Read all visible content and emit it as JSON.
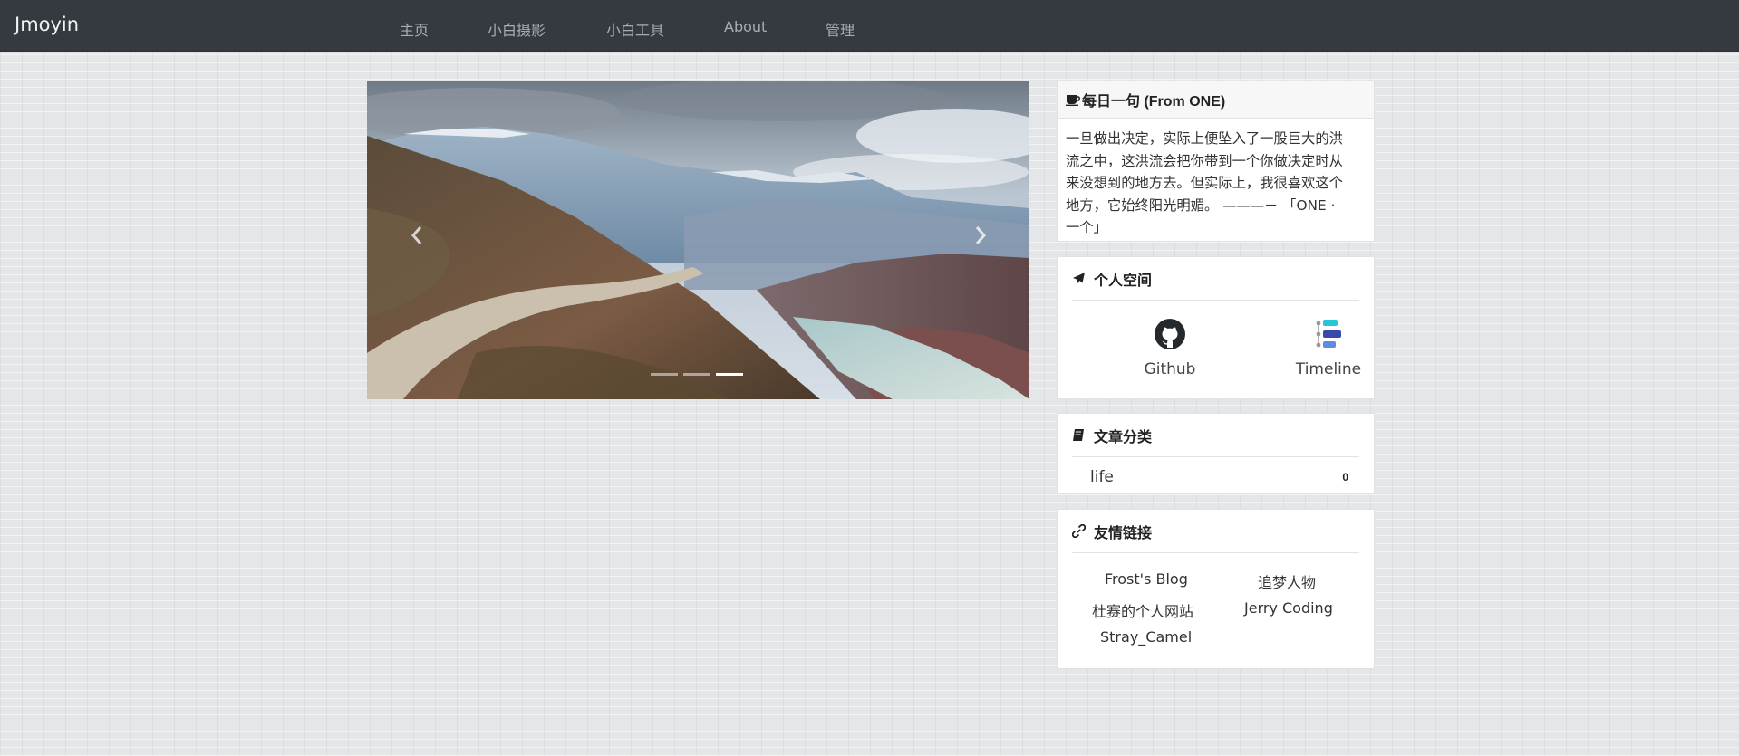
{
  "navbar": {
    "brand": "Jmoyin",
    "items": [
      "主页",
      "小白摄影",
      "小白工具",
      "About",
      "管理"
    ]
  },
  "carousel": {
    "slide_count": 3,
    "active_index": 2,
    "prev_icon": "chevron-left-icon",
    "next_icon": "chevron-right-icon"
  },
  "daily": {
    "title": "每日一句 (From ONE)",
    "icon": "coffee-cup-icon",
    "lines": [
      "一旦做出决定，实际上便坠入了一股巨大的洪",
      "流之中，这洪流会把你带到一个你做决定时从",
      "来没想到的地方去。但实际上，我很喜欢这个",
      "地方，它始终阳光明媚。 ———－ 「ONE ·",
      "一个」"
    ]
  },
  "space": {
    "title": "个人空间",
    "icon": "paper-plane-icon",
    "items": [
      {
        "label": "Github",
        "icon": "github-icon"
      },
      {
        "label": "Timeline",
        "icon": "timeline-icon"
      }
    ]
  },
  "categories": {
    "title": "文章分类",
    "icon": "book-icon",
    "items": [
      {
        "name": "life",
        "count": "0"
      }
    ]
  },
  "links": {
    "title": "友情链接",
    "icon": "link-icon",
    "items": [
      "Frost's Blog",
      "追梦人物",
      "杜赛的个人网站",
      "Jerry Coding",
      "Stray_Camel"
    ]
  },
  "colors": {
    "navbar_bg": "#343a40",
    "page_bg": "#e4e6e8",
    "card_bg": "#ffffff"
  }
}
